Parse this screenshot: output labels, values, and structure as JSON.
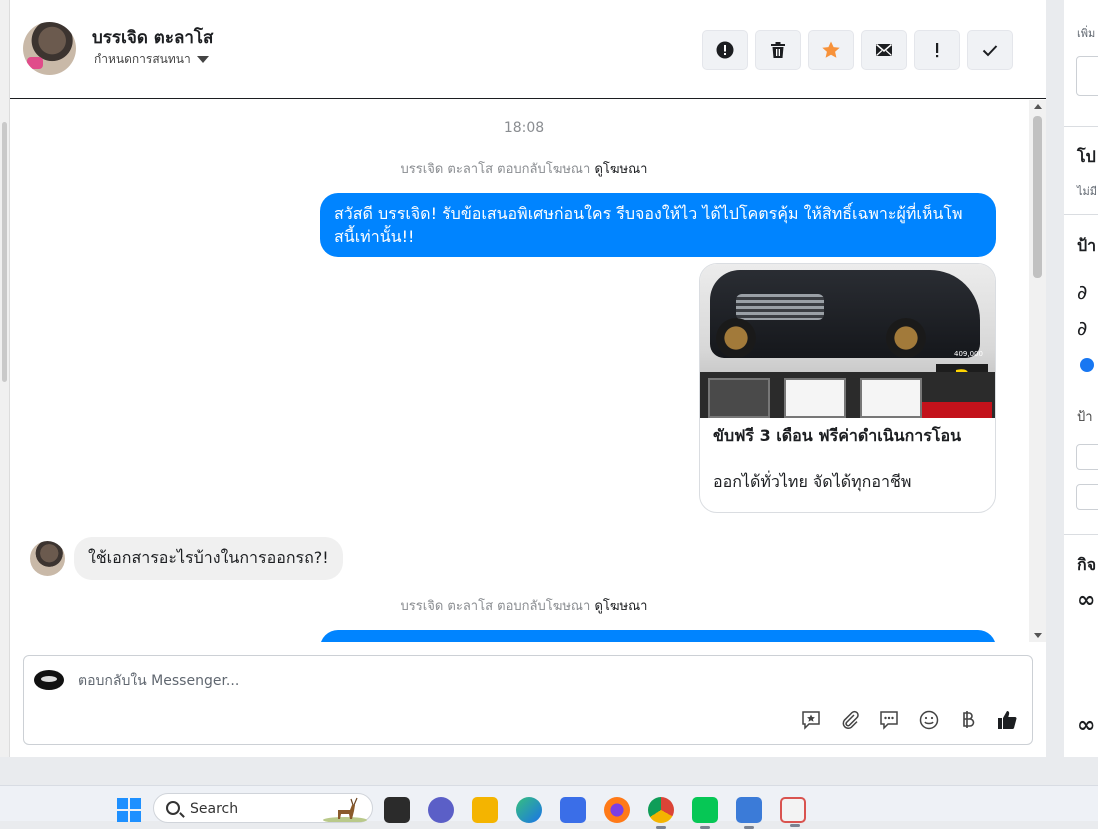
{
  "header": {
    "contact_name": "บรรเจิด ตะลาโส",
    "assign_label": "กำหนดการสนทนา",
    "toolbar": [
      {
        "icon": "alert-circle-icon"
      },
      {
        "icon": "trash-icon"
      },
      {
        "icon": "star-icon",
        "color": "#f7923a"
      },
      {
        "icon": "envelope-icon"
      },
      {
        "icon": "exclamation-icon"
      },
      {
        "icon": "check-icon"
      }
    ]
  },
  "thread": {
    "timestamp": "18:08",
    "reply_note_1": {
      "text": "บรรเจิด ตะลาโส ตอบกลับโฆษณา",
      "link": "ดูโฆษณา"
    },
    "outgoing_1": "สวัสดี บรรเจิด! รับข้อเสนอพิเศษก่อนใคร รีบจองให้ไว ได้ไปโคตรคุ้ม ให้สิทธิ์เฉพาะผู้ที่เห็นโพสนี้เท่านั้น!!",
    "card": {
      "title": "ขับฟรี 3 เดือน ฟรีค่าดำเนินการโอน",
      "subtitle": "ออกได้ทั่วไทย จัดได้ทุกอาชีพ",
      "image_badge": "3",
      "image_price": "409,000"
    },
    "incoming_1": "ใช้เอกสารอะไรบ้างในการออกรถ?!",
    "reply_note_2": {
      "text": "บรรเจิด ตะลาโส ตอบกลับโฆษณา",
      "link": "ดูโฆษณา"
    }
  },
  "composer": {
    "placeholder": "ตอบกลับใน Messenger...",
    "icons": [
      "saved-reply-icon",
      "paperclip-icon",
      "chat-bubble-icon",
      "emoji-icon",
      "baht-icon",
      "thumbs-up-icon"
    ]
  },
  "sidebar": {
    "items": [
      "เพิ่ม",
      "โป",
      "ไม่มี",
      "ป้า",
      "ป้า",
      "กิจ"
    ]
  },
  "taskbar": {
    "search_label": "Search",
    "apps": [
      "file-explorer-icon",
      "teams-icon",
      "folder-icon",
      "edge-icon",
      "store-icon",
      "firefox-icon",
      "chrome-icon",
      "line-icon",
      "notepad-icon",
      "snipping-icon"
    ]
  },
  "colors": {
    "accent": "#0084ff",
    "bubble_in": "#f0f0f0"
  }
}
